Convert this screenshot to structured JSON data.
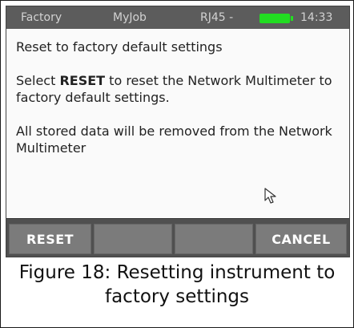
{
  "status_bar": {
    "app": "Factory",
    "job": "MyJob",
    "port": "RJ45 -",
    "time": "14:33",
    "battery_color": "#22dd22"
  },
  "content": {
    "title": "Reset to factory default settings",
    "select_prefix": "Select ",
    "select_keyword": "RESET",
    "select_suffix": " to reset the Network Multimeter to factory default settings.",
    "data_warning": "All stored data will be removed from the Network Multimeter"
  },
  "softkeys": {
    "key1": "RESET",
    "key2": "",
    "key3": "",
    "key4": "CANCEL"
  },
  "caption": "Figure 18: Resetting instrument to factory settings"
}
